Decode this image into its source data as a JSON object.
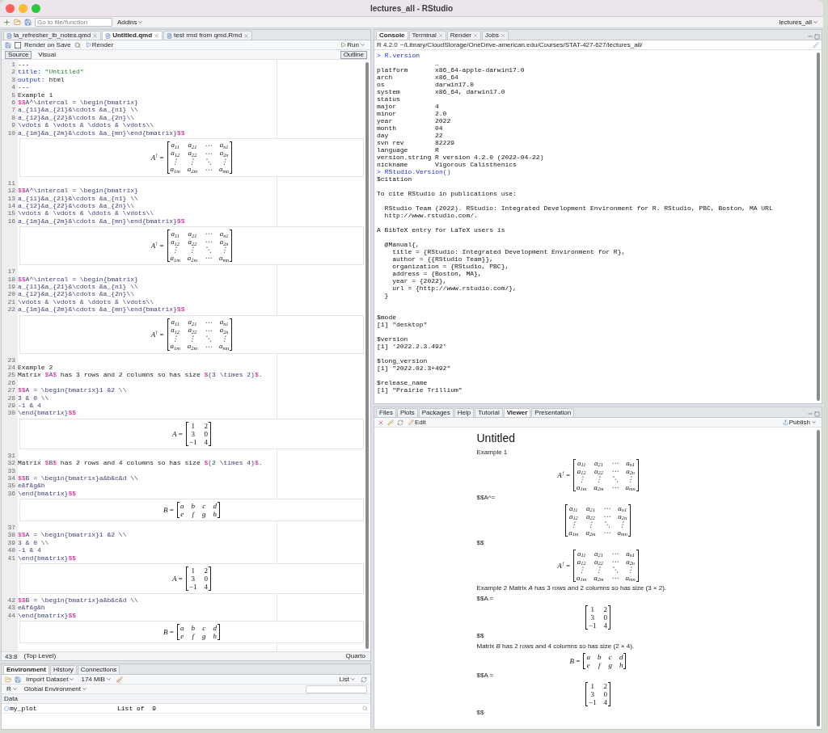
{
  "window": {
    "title": "lectures_all - RStudio"
  },
  "toolbar": {
    "search_placeholder": "Go to file/function",
    "addins": "Addins",
    "project": "lectures_all"
  },
  "editor": {
    "tabs": [
      {
        "label": "la_refresher_lb_notes.qmd",
        "selected": false
      },
      {
        "label": "Untitled.qmd",
        "selected": true
      },
      {
        "label": "test rmd from qmd.Rmd",
        "selected": false
      }
    ],
    "render_on_save": {
      "label": "Render on Save",
      "checked": false
    },
    "render_label": "Render",
    "run_label": "Run",
    "outline_label": "Outline",
    "modes": [
      {
        "label": "Source",
        "selected": true
      },
      {
        "label": "Visual",
        "selected": false
      }
    ],
    "blocks": [
      {
        "lines": [
          {
            "number": "1",
            "tokens": [
              {
                "kind": "plain",
                "text": "---"
              }
            ]
          },
          {
            "number": "2",
            "tokens": [
              {
                "kind": "key",
                "text": "title:"
              },
              {
                "kind": "string",
                "text": " \"Untitled\""
              }
            ]
          },
          {
            "number": "3",
            "tokens": [
              {
                "kind": "key",
                "text": "output:"
              },
              {
                "kind": "plain",
                "text": " html"
              }
            ]
          },
          {
            "number": "4",
            "tokens": [
              {
                "kind": "plain",
                "text": "---"
              }
            ]
          },
          {
            "number": "5",
            "tokens": [
              {
                "kind": "plain",
                "text": "Example 1"
              }
            ]
          },
          {
            "number": "6",
            "tokens": [
              {
                "kind": "delim",
                "text": "$$"
              },
              {
                "kind": "math",
                "text": "A^\\intercal = \\begin{bmatrix}"
              }
            ]
          },
          {
            "number": "7",
            "tokens": [
              {
                "kind": "math",
                "text": "a_{11}&a_{21}&\\cdots &a_{n1} \\\\"
              }
            ]
          },
          {
            "number": "8",
            "tokens": [
              {
                "kind": "math",
                "text": "a_{12}&a_{22}&\\cdots &a_{2n}\\\\"
              }
            ]
          },
          {
            "number": "9",
            "tokens": [
              {
                "kind": "math",
                "text": "\\vdots & \\vdots & \\ddots & \\vdots\\\\"
              }
            ]
          },
          {
            "number": "10",
            "tokens": [
              {
                "kind": "math",
                "text": "a_{1m}&a_{2m}&\\cdots &a_{mn}\\end{bmatrix}"
              },
              {
                "kind": "delim",
                "text": "$$"
              }
            ]
          }
        ],
        "output": {
          "lhs": "*A*$^{⊺}$ =",
          "italic": true,
          "rows": [
            [
              "a$_{11}$",
              "a$_{21}$",
              "⋯",
              "a$_{n1}$"
            ],
            [
              "a$_{12}$",
              "a$_{22}$",
              "⋯",
              "a$_{2n}$"
            ],
            [
              "⋮",
              "⋮",
              "⋱",
              "⋮"
            ],
            [
              "a$_{1m}$",
              "a$_{2m}$",
              "⋯",
              "a$_{mn}$"
            ]
          ]
        }
      },
      {
        "lines": [
          {
            "number": "11"
          },
          {
            "number": "12",
            "tokens": [
              {
                "kind": "delim",
                "text": "$$"
              },
              {
                "kind": "math",
                "text": "A^\\intercal = \\begin{bmatrix}"
              }
            ]
          },
          {
            "number": "13",
            "tokens": [
              {
                "kind": "math",
                "text": "a_{11}&a_{21}&\\cdots &a_{n1} \\\\"
              }
            ]
          },
          {
            "number": "14",
            "tokens": [
              {
                "kind": "math",
                "text": "a_{12}&a_{22}&\\cdots &a_{2n}\\\\"
              }
            ]
          },
          {
            "number": "15",
            "tokens": [
              {
                "kind": "math",
                "text": "\\vdots & \\vdots & \\ddots & \\vdots\\\\"
              }
            ]
          },
          {
            "number": "16",
            "tokens": [
              {
                "kind": "math",
                "text": "a_{1m}&a_{2m}&\\cdots &a_{mn}\\end{bmatrix}"
              },
              {
                "kind": "delim",
                "text": "$$"
              }
            ]
          }
        ],
        "output": {
          "lhs": "*A*$^{⊺}$ =",
          "italic": true,
          "rows": [
            [
              "a$_{11}$",
              "a$_{21}$",
              "⋯",
              "a$_{n1}$"
            ],
            [
              "a$_{12}$",
              "a$_{22}$",
              "⋯",
              "a$_{2n}$"
            ],
            [
              "⋮",
              "⋮",
              "⋱",
              "⋮"
            ],
            [
              "a$_{1m}$",
              "a$_{2m}$",
              "⋯",
              "a$_{mn}$"
            ]
          ]
        }
      },
      {
        "lines": [
          {
            "number": "17"
          },
          {
            "number": "18",
            "tokens": [
              {
                "kind": "delim",
                "text": "$$"
              },
              {
                "kind": "math",
                "text": "A^\\intercal = \\begin{bmatrix}"
              }
            ]
          },
          {
            "number": "19",
            "tokens": [
              {
                "kind": "math",
                "text": "a_{11}&a_{21}&\\cdots &a_{n1} \\\\"
              }
            ]
          },
          {
            "number": "20",
            "tokens": [
              {
                "kind": "math",
                "text": "a_{12}&a_{22}&\\cdots &a_{2n}\\\\"
              }
            ]
          },
          {
            "number": "21",
            "tokens": [
              {
                "kind": "math",
                "text": "\\vdots & \\vdots & \\ddots & \\vdots\\\\"
              }
            ]
          },
          {
            "number": "22",
            "tokens": [
              {
                "kind": "math",
                "text": "a_{1m}&a_{2m}&\\cdots &a_{mn}\\end{bmatrix}"
              },
              {
                "kind": "delim",
                "text": "$$"
              }
            ]
          }
        ],
        "output": {
          "lhs": "*A*$^{⊺}$ =",
          "italic": true,
          "rows": [
            [
              "a$_{11}$",
              "a$_{21}$",
              "⋯",
              "a$_{n1}$"
            ],
            [
              "a$_{12}$",
              "a$_{22}$",
              "⋯",
              "a$_{2n}$"
            ],
            [
              "⋮",
              "⋮",
              "⋱",
              "⋮"
            ],
            [
              "a$_{1m}$",
              "a$_{2m}$",
              "⋯",
              "a$_{mn}$"
            ]
          ]
        }
      },
      {
        "lines": [
          {
            "number": "23"
          },
          {
            "number": "24",
            "tokens": [
              {
                "kind": "plain",
                "text": "Example 2"
              }
            ]
          },
          {
            "number": "25",
            "tokens": [
              {
                "kind": "plain",
                "text": "Matrix "
              },
              {
                "kind": "delim",
                "text": "$"
              },
              {
                "kind": "math",
                "text": "A"
              },
              {
                "kind": "delim",
                "text": "$"
              },
              {
                "kind": "plain",
                "text": " has 3 rows and 2 columns so has size "
              },
              {
                "kind": "delim",
                "text": "$"
              },
              {
                "kind": "math",
                "text": "(3 \\times 2)"
              },
              {
                "kind": "delim",
                "text": "$"
              },
              {
                "kind": "plain",
                "text": "."
              }
            ]
          },
          {
            "number": "26"
          },
          {
            "number": "27",
            "tokens": [
              {
                "kind": "delim",
                "text": "$$"
              },
              {
                "kind": "math",
                "text": "A = \\begin{bmatrix}1 &2 \\\\"
              }
            ]
          },
          {
            "number": "28",
            "tokens": [
              {
                "kind": "math",
                "text": "3 & 0 \\\\"
              }
            ]
          },
          {
            "number": "29",
            "tokens": [
              {
                "kind": "math",
                "text": "-1 & 4"
              }
            ]
          },
          {
            "number": "30",
            "tokens": [
              {
                "kind": "math",
                "text": "\\end{bmatrix}"
              },
              {
                "kind": "delim",
                "text": "$$"
              }
            ]
          }
        ],
        "output": {
          "lhs": "*A* =",
          "italic": false,
          "rows": [
            [
              "1",
              "2"
            ],
            [
              "3",
              "0"
            ],
            [
              "−1",
              "4"
            ]
          ]
        }
      },
      {
        "lines": [
          {
            "number": "31"
          },
          {
            "number": "32",
            "tokens": [
              {
                "kind": "plain",
                "text": "Matrix "
              },
              {
                "kind": "delim",
                "text": "$"
              },
              {
                "kind": "math",
                "text": "B"
              },
              {
                "kind": "delim",
                "text": "$"
              },
              {
                "kind": "plain",
                "text": " has 2 rows and 4 columns so has size "
              },
              {
                "kind": "delim",
                "text": "$"
              },
              {
                "kind": "math",
                "text": "(2 \\times 4)"
              },
              {
                "kind": "delim",
                "text": "$"
              },
              {
                "kind": "plain",
                "text": "."
              }
            ]
          },
          {
            "number": "33"
          },
          {
            "number": "34",
            "tokens": [
              {
                "kind": "delim",
                "text": "$$"
              },
              {
                "kind": "math",
                "text": "B = \\begin{bmatrix}a&b&c&d \\\\"
              }
            ]
          },
          {
            "number": "35",
            "tokens": [
              {
                "kind": "math",
                "text": "e&f&g&h"
              }
            ]
          },
          {
            "number": "36",
            "tokens": [
              {
                "kind": "math",
                "text": "\\end{bmatrix}"
              },
              {
                "kind": "delim",
                "text": "$$"
              }
            ]
          }
        ],
        "output": {
          "lhs": "*B* =",
          "italic": true,
          "rows": [
            [
              "a",
              "b",
              "c",
              "d"
            ],
            [
              "e",
              "f",
              "g",
              "h"
            ]
          ]
        }
      },
      {
        "lines": [
          {
            "number": "37"
          },
          {
            "number": "38",
            "tokens": [
              {
                "kind": "delim",
                "text": "$$"
              },
              {
                "kind": "math",
                "text": "A = \\begin{bmatrix}1 &2 \\\\"
              }
            ]
          },
          {
            "number": "39",
            "tokens": [
              {
                "kind": "math",
                "text": "3 & 0 \\\\"
              }
            ]
          },
          {
            "number": "40",
            "tokens": [
              {
                "kind": "math",
                "text": "-1 & 4"
              }
            ]
          },
          {
            "number": "41",
            "tokens": [
              {
                "kind": "math",
                "text": "\\end{bmatrix}"
              },
              {
                "kind": "delim",
                "text": "$$"
              }
            ]
          }
        ],
        "output": {
          "lhs": "*A* =",
          "italic": false,
          "rows": [
            [
              "1",
              "2"
            ],
            [
              "3",
              "0"
            ],
            [
              "−1",
              "4"
            ]
          ]
        }
      },
      {
        "lines": [
          {
            "number": "42",
            "tokens": [
              {
                "kind": "delim",
                "text": "$$"
              },
              {
                "kind": "math",
                "text": "B = \\begin{bmatrix}a&b&c&d \\\\"
              }
            ]
          },
          {
            "number": "43",
            "tokens": [
              {
                "kind": "math",
                "text": "e&f&g&h"
              }
            ]
          },
          {
            "number": "44",
            "tokens": [
              {
                "kind": "math",
                "text": "\\end{bmatrix}"
              },
              {
                "kind": "delim",
                "text": "$$"
              }
            ]
          }
        ],
        "output": {
          "lhs": "*B* =",
          "italic": true,
          "rows": [
            [
              "a",
              "b",
              "c",
              "d"
            ],
            [
              "e",
              "f",
              "g",
              "h"
            ]
          ]
        }
      }
    ],
    "status": {
      "position": "43:8",
      "scope": "(Top Level)",
      "file_type": "Quarto"
    }
  },
  "environment": {
    "tabs": [
      {
        "label": "Environment",
        "selected": true
      },
      {
        "label": "History",
        "selected": false
      },
      {
        "label": "Connections",
        "selected": false
      }
    ],
    "import_label": "Import Dataset",
    "memory": "174 MiB",
    "view": "List",
    "language": "R",
    "scope": "Global Environment",
    "section": "Data",
    "rows": [
      {
        "name": "my_plot",
        "value": "List of  9"
      }
    ]
  },
  "console": {
    "tabs": [
      {
        "label": "Console",
        "selected": true,
        "closable": false
      },
      {
        "label": "Terminal",
        "selected": false,
        "closable": true
      },
      {
        "label": "Render",
        "selected": false,
        "closable": true
      },
      {
        "label": "Jobs",
        "selected": false,
        "closable": true
      }
    ],
    "version": "R 4.2.0",
    "path": "~/Library/CloudStorage/OneDrive-american.edu/Courses/STAT-427-627/lectures_all/",
    "prompt": ">",
    "lines": [
      {
        "kind": "input",
        "text": "R.version"
      },
      {
        "kind": "output",
        "text": "               _"
      },
      {
        "kind": "output",
        "text": "platform       x86_64-apple-darwin17.0"
      },
      {
        "kind": "output",
        "text": "arch           x86_64"
      },
      {
        "kind": "output",
        "text": "os             darwin17.0"
      },
      {
        "kind": "output",
        "text": "system         x86_64, darwin17.0"
      },
      {
        "kind": "output",
        "text": "status"
      },
      {
        "kind": "output",
        "text": "major          4"
      },
      {
        "kind": "output",
        "text": "minor          2.0"
      },
      {
        "kind": "output",
        "text": "year           2022"
      },
      {
        "kind": "output",
        "text": "month          04"
      },
      {
        "kind": "output",
        "text": "day            22"
      },
      {
        "kind": "output",
        "text": "svn rev        82229"
      },
      {
        "kind": "output",
        "text": "language       R"
      },
      {
        "kind": "output",
        "text": "version.string R version 4.2.0 (2022-04-22)"
      },
      {
        "kind": "output",
        "text": "nickname       Vigorous Calisthenics"
      },
      {
        "kind": "input",
        "text": "RStudio.Version()"
      },
      {
        "kind": "output",
        "text": "$citation"
      },
      {
        "kind": "blank"
      },
      {
        "kind": "output",
        "text": "To cite RStudio in publications use:"
      },
      {
        "kind": "blank"
      },
      {
        "kind": "output",
        "text": "  RStudio Team (2022). RStudio: Integrated Development Environment for R. RStudio, PBC, Boston, MA URL"
      },
      {
        "kind": "output",
        "text": "  http://www.rstudio.com/."
      },
      {
        "kind": "blank"
      },
      {
        "kind": "output",
        "text": "A BibTeX entry for LaTeX users is"
      },
      {
        "kind": "blank"
      },
      {
        "kind": "output",
        "text": "  @Manual{,"
      },
      {
        "kind": "output",
        "text": "    title = {RStudio: Integrated Development Environment for R},"
      },
      {
        "kind": "output",
        "text": "    author = {{RStudio Team}},"
      },
      {
        "kind": "output",
        "text": "    organization = {RStudio, PBC},"
      },
      {
        "kind": "output",
        "text": "    address = {Boston, MA},"
      },
      {
        "kind": "output",
        "text": "    year = {2022},"
      },
      {
        "kind": "output",
        "text": "    url = {http://www.rstudio.com/},"
      },
      {
        "kind": "output",
        "text": "  }"
      },
      {
        "kind": "blank"
      },
      {
        "kind": "blank"
      },
      {
        "kind": "output",
        "text": "$mode"
      },
      {
        "kind": "output",
        "text": "[1] \"desktop\""
      },
      {
        "kind": "blank"
      },
      {
        "kind": "output",
        "text": "$version"
      },
      {
        "kind": "output",
        "text": "[1] ‘2022.2.3.492’"
      },
      {
        "kind": "blank"
      },
      {
        "kind": "output",
        "text": "$long_version"
      },
      {
        "kind": "output",
        "text": "[1] \"2022.02.3+492\""
      },
      {
        "kind": "blank"
      },
      {
        "kind": "output",
        "text": "$release_name"
      },
      {
        "kind": "output",
        "text": "[1] \"Prairie Trillium\""
      }
    ]
  },
  "viewer": {
    "tabs": [
      {
        "label": "Files",
        "selected": false
      },
      {
        "label": "Plots",
        "selected": false
      },
      {
        "label": "Packages",
        "selected": false
      },
      {
        "label": "Help",
        "selected": false
      },
      {
        "label": "Tutorial",
        "selected": false
      },
      {
        "label": "Viewer",
        "selected": true
      },
      {
        "label": "Presentation",
        "selected": false
      }
    ],
    "edit_label": "Edit",
    "publish_label": "Publish",
    "title": "Untitled",
    "content": [
      {
        "kind": "text",
        "text": "Example 1"
      },
      {
        "kind": "math",
        "lhs": "*A*$^{⊺}$ =",
        "italic": true,
        "rows": [
          [
            "a$_{11}$",
            "a$_{21}$",
            "⋯",
            "a$_{n1}$"
          ],
          [
            "a$_{12}$",
            "a$_{22}$",
            "⋯",
            "a$_{2n}$"
          ],
          [
            "⋮",
            "⋮",
            "⋱",
            "⋮"
          ],
          [
            "a$_{1m}$",
            "a$_{2m}$",
            "⋯",
            "a$_{mn}$"
          ]
        ]
      },
      {
        "kind": "text",
        "text": "$$A^="
      },
      {
        "kind": "math",
        "italic": true,
        "rows": [
          [
            "a$_{11}$",
            "a$_{21}$",
            "⋯",
            "a$_{n1}$"
          ],
          [
            "a$_{12}$",
            "a$_{22}$",
            "⋯",
            "a$_{2n}$"
          ],
          [
            "⋮",
            "⋮",
            "⋱",
            "⋮"
          ],
          [
            "a$_{1m}$",
            "a$_{2m}$",
            "⋯",
            "a$_{mn}$"
          ]
        ]
      },
      {
        "kind": "text",
        "text": "$$"
      },
      {
        "kind": "math",
        "lhs": "*A*$^{⊺}$ =",
        "italic": true,
        "rows": [
          [
            "a$_{11}$",
            "a$_{21}$",
            "⋯",
            "a$_{n1}$"
          ],
          [
            "a$_{12}$",
            "a$_{22}$",
            "⋯",
            "a$_{2n}$"
          ],
          [
            "⋮",
            "⋮",
            "⋱",
            "⋮"
          ],
          [
            "a$_{1m}$",
            "a$_{2m}$",
            "⋯",
            "a$_{mn}$"
          ]
        ]
      },
      {
        "kind": "text",
        "text": "Example 2 Matrix *A* has 3 rows and 2 columns so has size (3 × 2)."
      },
      {
        "kind": "text",
        "text": "$$A ="
      },
      {
        "kind": "math",
        "italic": false,
        "rows": [
          [
            "1",
            "2"
          ],
          [
            "3",
            "0"
          ],
          [
            "−1",
            "4"
          ]
        ]
      },
      {
        "kind": "text",
        "text": "$$"
      },
      {
        "kind": "text",
        "text": "Matrix *B* has 2 rows and 4 columns so has size (2 × 4)."
      },
      {
        "kind": "math",
        "lhs": "*B* =",
        "italic": true,
        "rows": [
          [
            "a",
            "b",
            "c",
            "d"
          ],
          [
            "e",
            "f",
            "g",
            "h"
          ]
        ]
      },
      {
        "kind": "text",
        "text": "$$A ="
      },
      {
        "kind": "math",
        "italic": false,
        "rows": [
          [
            "1",
            "2"
          ],
          [
            "3",
            "0"
          ],
          [
            "−1",
            "4"
          ]
        ]
      },
      {
        "kind": "text",
        "text": "$$"
      }
    ]
  }
}
